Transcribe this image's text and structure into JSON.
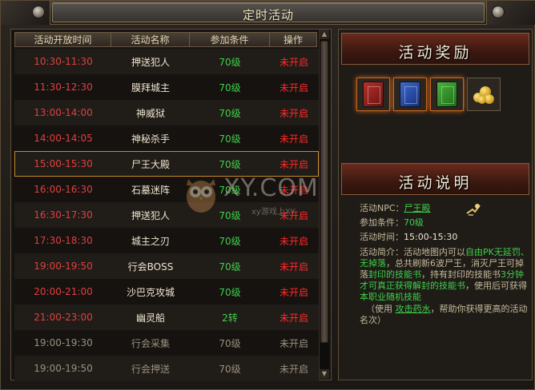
{
  "window": {
    "title": "定时活动"
  },
  "table": {
    "headers": [
      "活动开放时间",
      "活动名称",
      "参加条件",
      "操作"
    ],
    "rows": [
      {
        "time": "10:30-11:30",
        "name": "押送犯人",
        "cond": "70级",
        "status": "未开启",
        "active": true
      },
      {
        "time": "11:30-12:30",
        "name": "膜拜城主",
        "cond": "70级",
        "status": "未开启",
        "active": true
      },
      {
        "time": "13:00-14:00",
        "name": "神威狱",
        "cond": "70级",
        "status": "未开启",
        "active": true
      },
      {
        "time": "14:00-14:05",
        "name": "神秘杀手",
        "cond": "70级",
        "status": "未开启",
        "active": true
      },
      {
        "time": "15:00-15:30",
        "name": "尸王大殿",
        "cond": "70级",
        "status": "未开启",
        "active": true,
        "selected": true
      },
      {
        "time": "16:00-16:30",
        "name": "石墓迷阵",
        "cond": "70级",
        "status": "未开启",
        "active": true
      },
      {
        "time": "16:30-17:30",
        "name": "押送犯人",
        "cond": "70级",
        "status": "未开启",
        "active": true
      },
      {
        "time": "17:30-18:30",
        "name": "城主之刃",
        "cond": "70级",
        "status": "未开启",
        "active": true
      },
      {
        "time": "19:00-19:50",
        "name": "行会BOSS",
        "cond": "70级",
        "status": "未开启",
        "active": true
      },
      {
        "time": "20:00-21:00",
        "name": "沙巴克攻城",
        "cond": "70级",
        "status": "未开启",
        "active": true
      },
      {
        "time": "21:00-23:00",
        "name": "幽灵船",
        "cond": "2转",
        "status": "未开启",
        "active": true
      },
      {
        "time": "19:00-19:30",
        "name": "行会采集",
        "cond": "70级",
        "status": "未开启",
        "active": false
      },
      {
        "time": "19:00-19:50",
        "name": "行会押送",
        "cond": "70级",
        "status": "未开启",
        "active": false
      }
    ]
  },
  "rewards": {
    "title": "活动奖励",
    "items": [
      {
        "icon": "red-skill-book-icon",
        "color": "#b8302a"
      },
      {
        "icon": "blue-skill-book-icon",
        "color": "#3a6ad0"
      },
      {
        "icon": "green-skill-book-icon",
        "color": "#4ab43a"
      },
      {
        "icon": "gold-coins-icon",
        "color": "#e0b030"
      }
    ]
  },
  "info": {
    "title": "活动说明",
    "npc_label": "活动NPC：",
    "npc_value": "尸王殿",
    "cond_label": "参加条件：",
    "cond_value": "70级",
    "time_label": "活动时间：",
    "time_value": "15:00-15:30",
    "intro_label": "活动简介：",
    "intro_p1": "活动地图内可以",
    "intro_g1": "自由PK无延罚、无掉落",
    "intro_p2": "，总共刷新6波尸王，消灭尸王可掉落",
    "intro_g2": "封印的技能书",
    "intro_p3": "，持有封印的技能书",
    "intro_g3": "3分钟才可真正获得解封的技能书",
    "intro_p4": "，使用后可获得",
    "intro_g4": "本职业随机技能",
    "tip_p1": "（使用 ",
    "tip_link": "攻击药水",
    "tip_p2": "，帮助你获得更高的活动名次）"
  },
  "watermark": {
    "logo": "XY.COM",
    "sub": "xy游戏上XY"
  },
  "colors": {
    "active_time": "#e04040",
    "status": "#ff2a2a",
    "cond": "#3fd04a",
    "highlight": "#c88a2a"
  }
}
